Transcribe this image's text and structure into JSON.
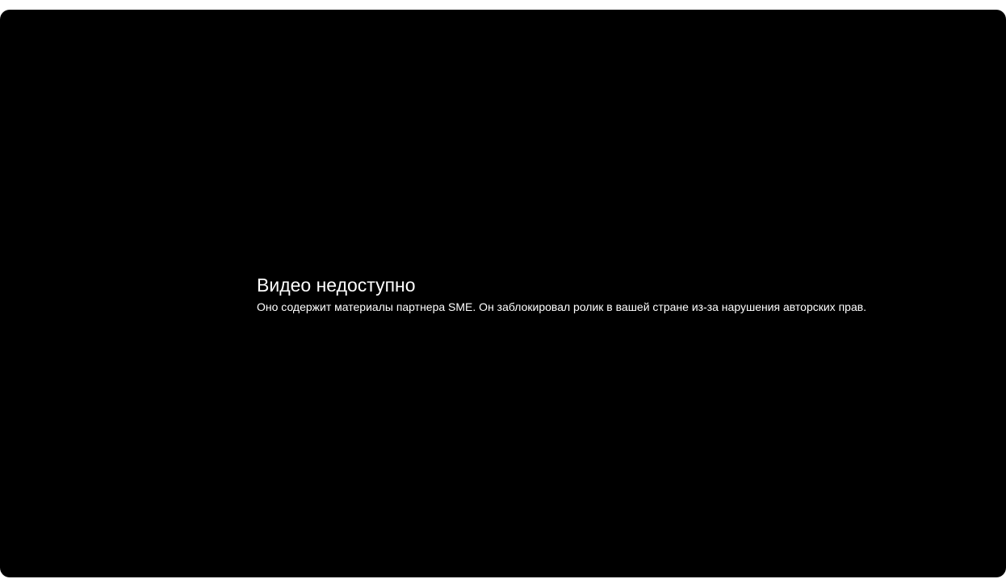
{
  "player": {
    "background_color": "#000000",
    "error": {
      "title": "Видео недоступно",
      "message": "Оно содержит материалы партнера SME. Он заблокировал ролик в вашей стране из-за нарушения авторских прав."
    }
  }
}
